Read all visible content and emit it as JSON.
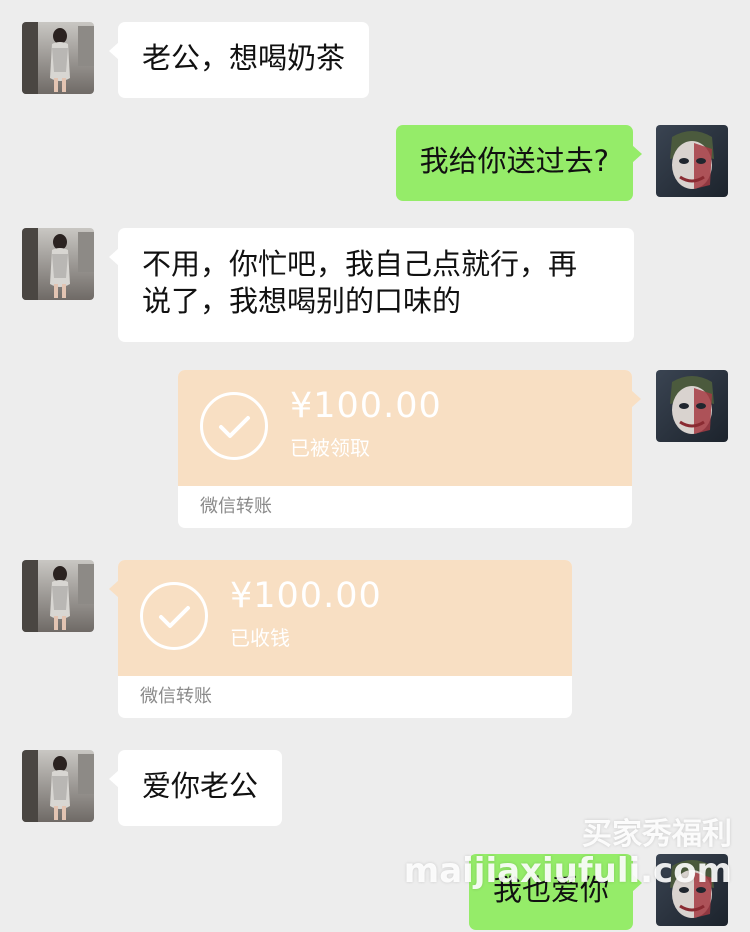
{
  "messages": [
    {
      "text": "老公，想喝奶茶"
    },
    {
      "text": "我给你送过去?"
    },
    {
      "line1": "不用，你忙吧，我自己点就行，再",
      "line2": "说了，我想喝别的口味的"
    },
    {
      "amount": "¥100.00",
      "status": "已被领取",
      "footer": "微信转账"
    },
    {
      "amount": "¥100.00",
      "status": "已收钱",
      "footer": "微信转账"
    },
    {
      "text": "爱你老公"
    },
    {
      "text": "我也爱你"
    }
  ],
  "watermark": {
    "cn": "买家秀福利",
    "en": "maijiaxiufuli.com"
  },
  "colors": {
    "background": "#ededed",
    "sent_bubble": "#95ec69",
    "received_bubble": "#ffffff",
    "transfer_card": "#f8dfc3"
  },
  "icons": {
    "transfer_status": "check-circle-icon",
    "her_avatar": "girl-photo-avatar",
    "his_avatar": "joker-face-avatar"
  }
}
